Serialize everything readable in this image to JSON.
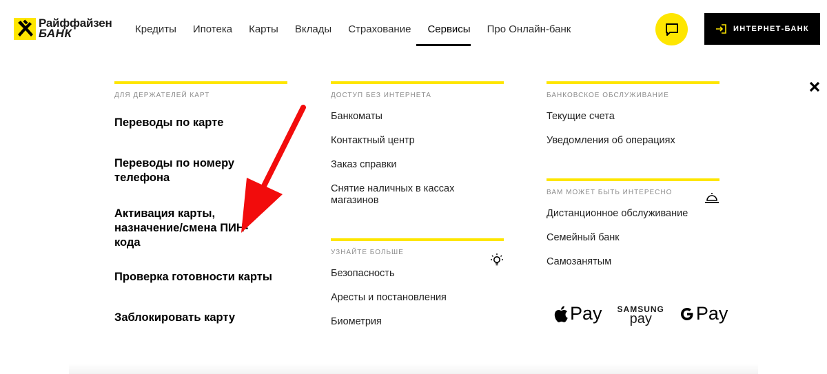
{
  "logo": {
    "line1": "Райффайзен",
    "line2": "БАНК"
  },
  "nav": {
    "items": [
      "Кредиты",
      "Ипотека",
      "Карты",
      "Вклады",
      "Страхование",
      "Сервисы",
      "Про Онлайн-банк"
    ],
    "active": "Сервисы"
  },
  "header_actions": {
    "bank_button_label": "ИНТЕРНЕТ-БАНК"
  },
  "menu": {
    "col1": {
      "caption": "ДЛЯ ДЕРЖАТЕЛЕЙ КАРТ",
      "links": [
        "Переводы по карте",
        "Переводы по номеру телефона",
        "Активация карты, назначение/смена ПИН-кода",
        "Проверка готовности карты",
        "Заблокировать карту"
      ]
    },
    "col2": {
      "caption": "ДОСТУП БЕЗ ИНТЕРНЕТА",
      "links": [
        "Банкоматы",
        "Контактный центр",
        "Заказ справки",
        "Снятие наличных в кассах магазинов"
      ],
      "caption2": "УЗНАЙТЕ БОЛЬШЕ",
      "links2": [
        "Безопасность",
        "Аресты и постановления",
        "Биометрия"
      ]
    },
    "col3": {
      "caption": "БАНКОВСКОЕ ОБСЛУЖИВАНИЕ",
      "links": [
        "Текущие счета",
        "Уведомления об операциях"
      ],
      "caption2": "ВАМ МОЖЕТ БЫТЬ ИНТЕРЕСНО",
      "links2": [
        "Дистанционное обслуживание",
        "Семейный банк",
        "Самозанятым"
      ]
    }
  },
  "payments": {
    "apple": "Pay",
    "samsung_top": "SAMSUNG",
    "samsung_bottom": "pay",
    "google": "Pay"
  },
  "colors": {
    "accent": "#fee600",
    "dark": "#000000",
    "arrow": "#f20c0c"
  }
}
